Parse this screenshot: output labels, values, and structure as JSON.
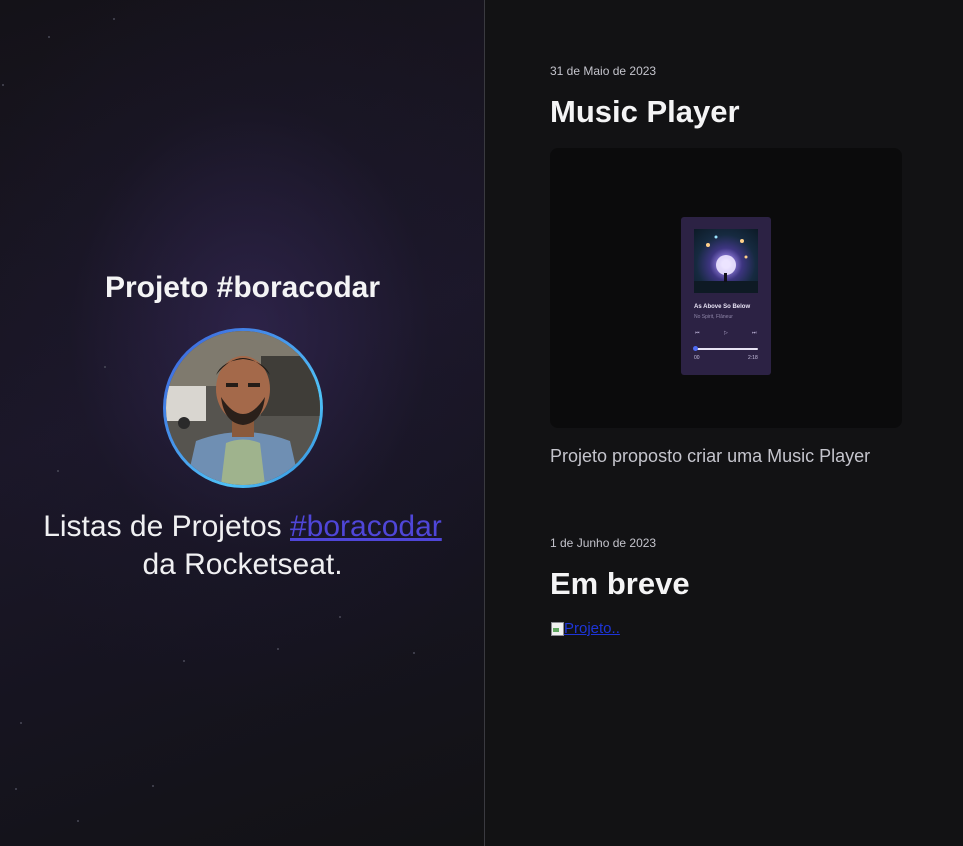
{
  "profile": {
    "heading": "Projeto #boracodar",
    "tagline_prefix": "Listas de Projetos ",
    "tagline_link": "#boracodar",
    "tagline_suffix": "da Rocketseat."
  },
  "projects": [
    {
      "date": "31 de Maio de 2023",
      "title": "Music Player",
      "player": {
        "song": "As Above So Below",
        "artist": "No Spirit, Flâneur",
        "time_start": "00",
        "time_end": "2:18"
      },
      "description": "Projeto proposto criar uma Music Player"
    },
    {
      "date": "1 de Junho de 2023",
      "title": "Em breve",
      "image_alt": "Projeto.."
    }
  ],
  "icons": {
    "prev": "prev-icon",
    "play": "play-icon",
    "next": "next-icon",
    "broken_image": "broken-image-icon"
  },
  "colors": {
    "link": "#4f46d8",
    "background": "#121214",
    "text": "#e1e1e6"
  }
}
